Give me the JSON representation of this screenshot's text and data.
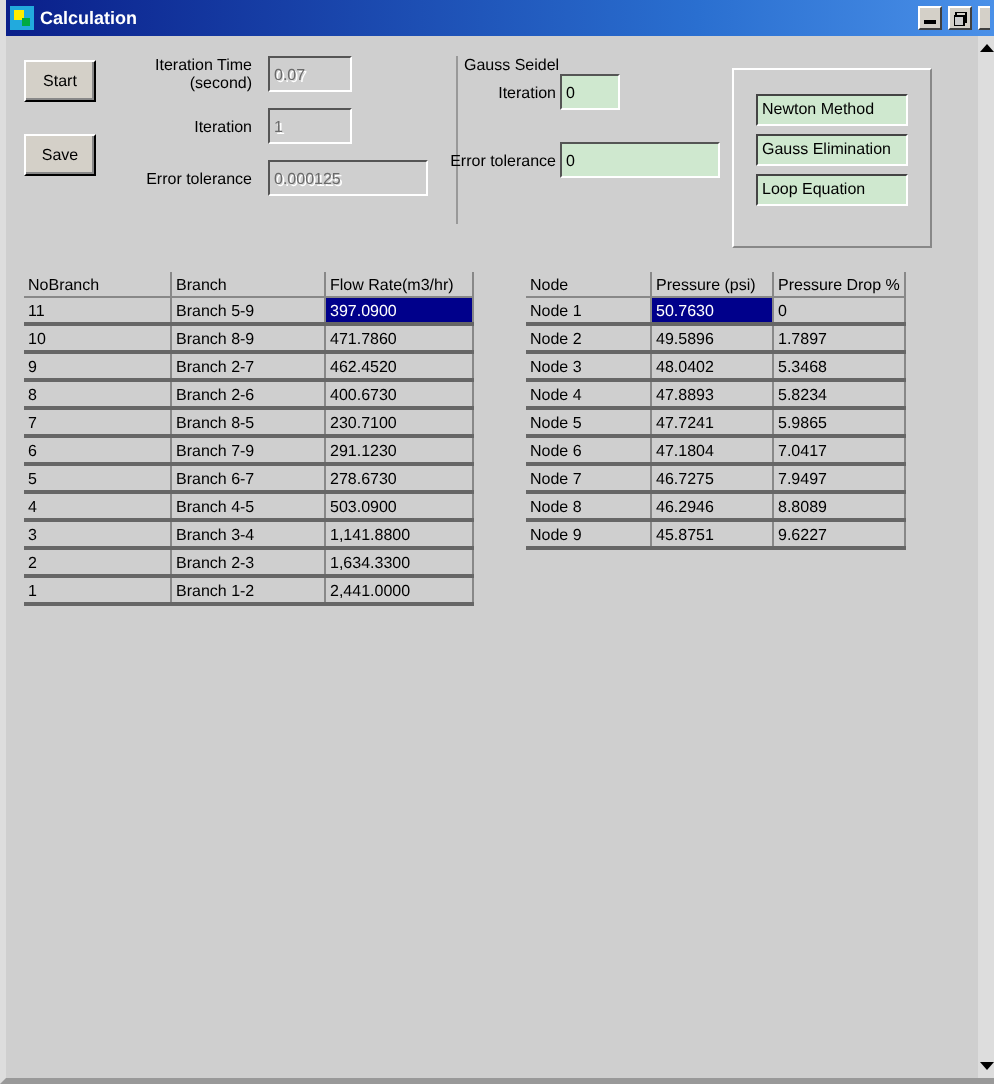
{
  "window": {
    "title": "Calculation"
  },
  "buttons": [
    "Start",
    "Save"
  ],
  "fields": [
    {
      "label": "Iteration Time (second)",
      "value": "0.07",
      "disabled": true
    },
    {
      "label": "Iteration",
      "value": "1",
      "disabled": true
    },
    {
      "label": "Error tolerance",
      "value": "0.000125",
      "disabled": true
    }
  ],
  "gauss_seidel": {
    "title": "Gauss Seidel",
    "fields": [
      {
        "label": "Iteration",
        "value": "0"
      },
      {
        "label": "Error tolerance",
        "value": "0"
      }
    ]
  },
  "methods": [
    "Newton Method",
    "Gauss Elimination",
    "Loop Equation"
  ],
  "branch_table": {
    "columns": [
      "NoBranch",
      "Branch",
      "Flow Rate(m3/hr)"
    ],
    "rows": [
      {
        "cells": [
          "11",
          "Branch 5-9",
          "397.0900"
        ],
        "selected": true
      },
      {
        "cells": [
          "10",
          "Branch 8-9",
          "471.7860"
        ],
        "selected": false
      },
      {
        "cells": [
          "9",
          "Branch 2-7",
          "462.4520"
        ],
        "selected": false
      },
      {
        "cells": [
          "8",
          "Branch 2-6",
          "400.6730"
        ],
        "selected": false
      },
      {
        "cells": [
          "7",
          "Branch 8-5",
          "230.7100"
        ],
        "selected": false
      },
      {
        "cells": [
          "6",
          "Branch 7-9",
          "291.1230"
        ],
        "selected": false
      },
      {
        "cells": [
          "5",
          "Branch 6-7",
          "278.6730"
        ],
        "selected": false
      },
      {
        "cells": [
          "4",
          "Branch 4-5",
          "503.0900"
        ],
        "selected": false
      },
      {
        "cells": [
          "3",
          "Branch 3-4",
          "1,141.8800"
        ],
        "selected": false
      },
      {
        "cells": [
          "2",
          "Branch 2-3",
          "1,634.3300"
        ],
        "selected": false
      },
      {
        "cells": [
          "1",
          "Branch 1-2",
          "2,441.0000"
        ],
        "selected": false
      }
    ]
  },
  "node_table": {
    "columns": [
      "Node",
      "Pressure (psi)",
      "Pressure Drop %"
    ],
    "rows": [
      {
        "cells": [
          "Node 1",
          "50.7630",
          "0"
        ],
        "selected": true
      },
      {
        "cells": [
          "Node 2",
          "49.5896",
          "1.7897"
        ],
        "selected": false
      },
      {
        "cells": [
          "Node 3",
          "48.0402",
          "5.3468"
        ],
        "selected": false
      },
      {
        "cells": [
          "Node 4",
          "47.8893",
          "5.8234"
        ],
        "selected": false
      },
      {
        "cells": [
          "Node 5",
          "47.7241",
          "5.9865"
        ],
        "selected": false
      },
      {
        "cells": [
          "Node 6",
          "47.1804",
          "7.0417"
        ],
        "selected": false
      },
      {
        "cells": [
          "Node 7",
          "46.7275",
          "7.9497"
        ],
        "selected": false
      },
      {
        "cells": [
          "Node 8",
          "46.2946",
          "8.8089"
        ],
        "selected": false
      },
      {
        "cells": [
          "Node 9",
          "45.8751",
          "9.6227"
        ],
        "selected": false
      }
    ]
  }
}
